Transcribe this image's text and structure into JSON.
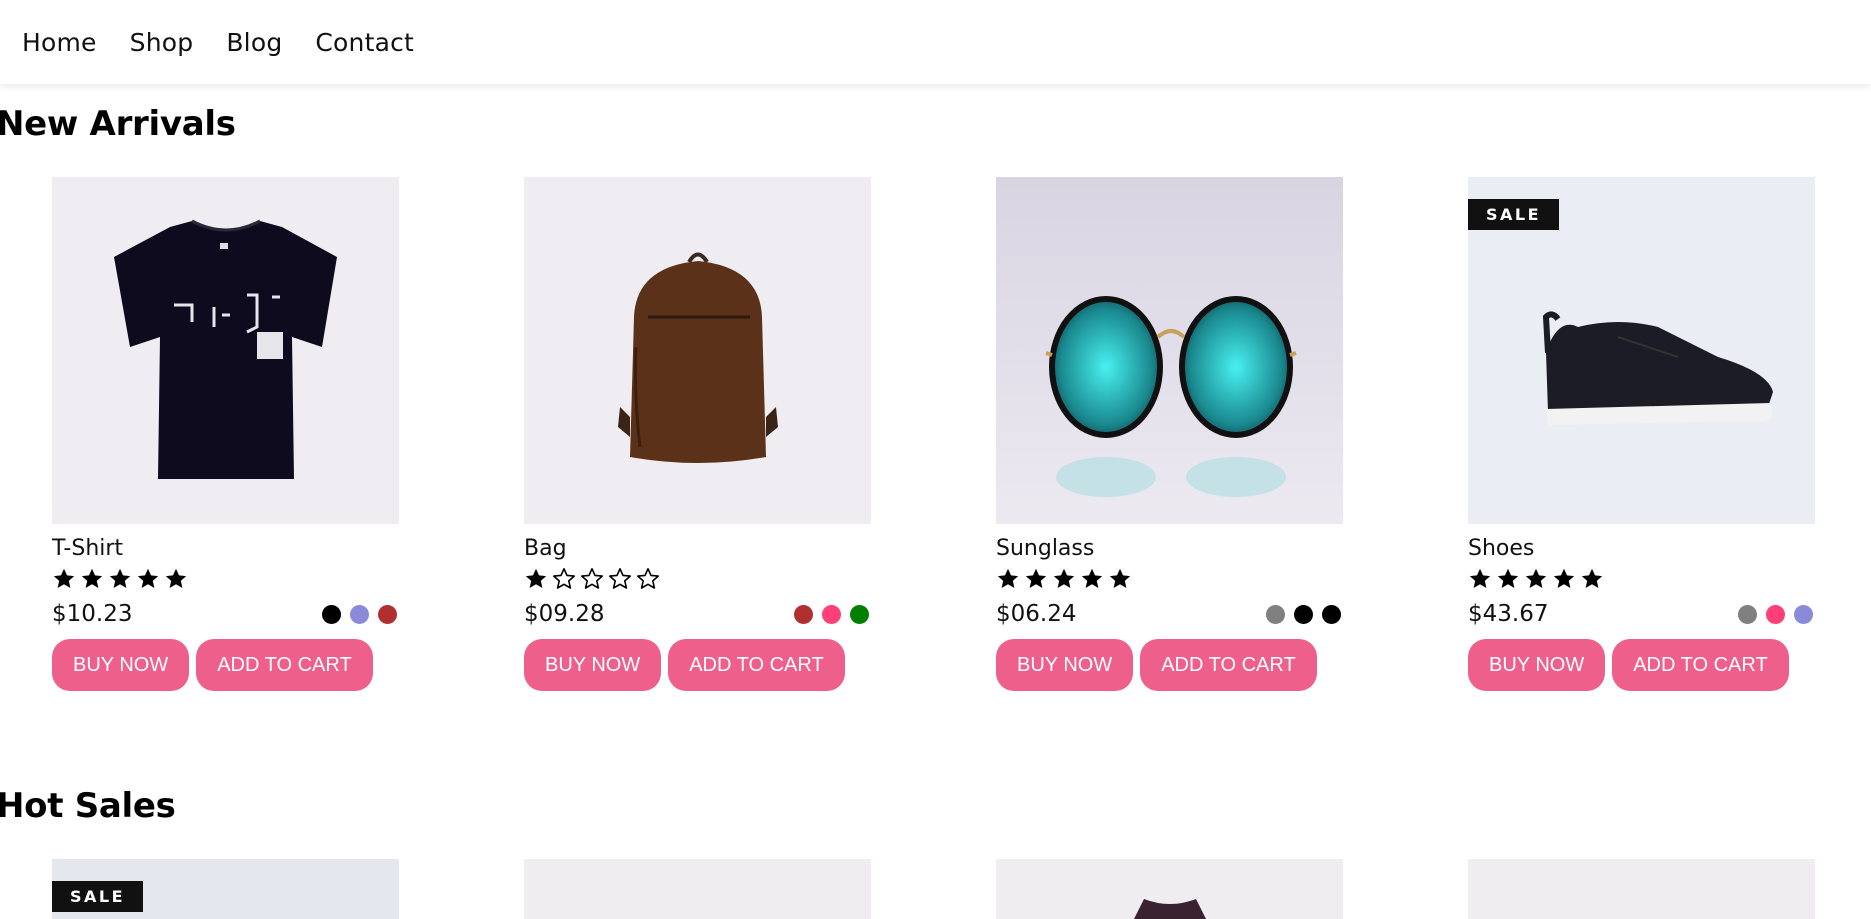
{
  "nav": {
    "items": [
      "Home",
      "Shop",
      "Blog",
      "Contact"
    ]
  },
  "sections": {
    "new_arrivals": {
      "title": "New Arrivals"
    },
    "hot_sales": {
      "title": "Hot Sales"
    }
  },
  "products": [
    {
      "name": "T-Shirt",
      "price": "$10.23",
      "rating": 5,
      "badge": "",
      "swatches": [
        "#000000",
        "#8a8ad8",
        "#b03030"
      ]
    },
    {
      "name": "Bag",
      "price": "$09.28",
      "rating": 1,
      "badge": "",
      "swatches": [
        "#b03030",
        "#ff3f7a",
        "#008000"
      ]
    },
    {
      "name": "Sunglass",
      "price": "$06.24",
      "rating": 5,
      "badge": "",
      "swatches": [
        "#808080",
        "#000000",
        "#000000"
      ]
    },
    {
      "name": "Shoes",
      "price": "$43.67",
      "rating": 5,
      "badge": "SALE",
      "swatches": [
        "#808080",
        "#ff3f7a",
        "#8a8ad8"
      ]
    }
  ],
  "buttons": {
    "buy_now": "BUY NOW",
    "add_to_cart": "ADD TO CART"
  },
  "hot_sales_preview": [
    {
      "badge": "SALE"
    },
    {
      "badge": ""
    },
    {
      "badge": ""
    },
    {
      "badge": ""
    }
  ],
  "colors": {
    "accent": "#ef5f8c",
    "badge_bg": "#111111"
  }
}
